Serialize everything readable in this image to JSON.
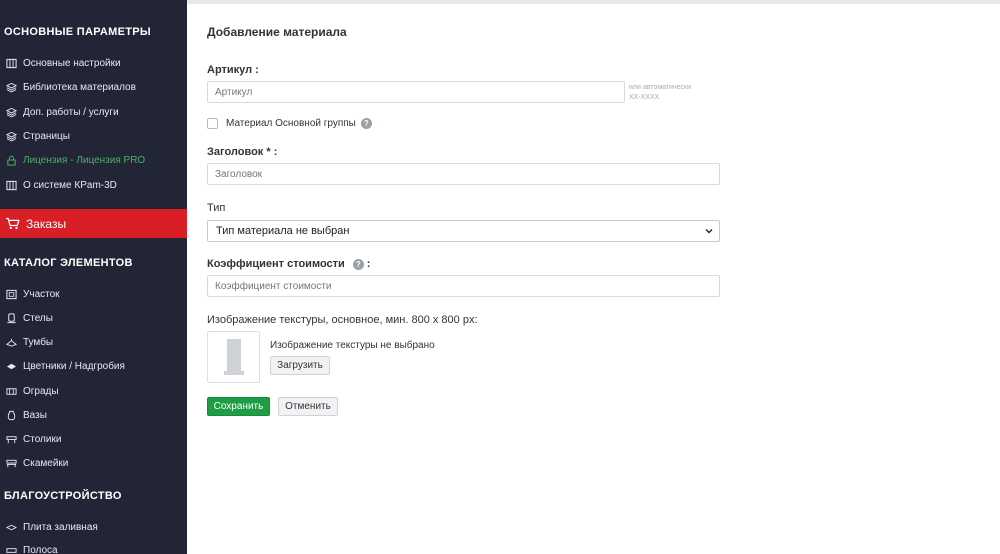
{
  "sidebar": {
    "sections": [
      {
        "title": "ОСНОВНЫЕ ПАРАМЕТРЫ"
      },
      {
        "title": "КАТАЛОГ ЭЛЕМЕНТОВ"
      },
      {
        "title": "БЛАГОУСТРОЙСТВО"
      }
    ],
    "main_items": [
      {
        "label": "Основные настройки",
        "icon": "columns-icon"
      },
      {
        "label": "Библиотека материалов",
        "icon": "layers-icon"
      },
      {
        "label": "Доп. работы / услуги",
        "icon": "layers-icon"
      },
      {
        "label": "Страницы",
        "icon": "layers-icon"
      },
      {
        "label": "Лицензия - Лицензия PRO",
        "icon": "lock-icon"
      },
      {
        "label": "О системе КРam-3D",
        "icon": "columns-icon"
      }
    ],
    "orders": {
      "label": "Заказы",
      "icon": "cart-icon"
    },
    "catalog_items": [
      {
        "label": "Участок",
        "icon": "plot-icon"
      },
      {
        "label": "Стелы",
        "icon": "stele-icon"
      },
      {
        "label": "Тумбы",
        "icon": "pedestal-icon"
      },
      {
        "label": "Цветники / Надгробия",
        "icon": "flowerbed-icon"
      },
      {
        "label": "Ограды",
        "icon": "fence-icon"
      },
      {
        "label": "Вазы",
        "icon": "vase-icon"
      },
      {
        "label": "Столики",
        "icon": "table-icon"
      },
      {
        "label": "Скамейки",
        "icon": "bench-icon"
      }
    ],
    "landscape_items": [
      {
        "label": "Плита заливная",
        "icon": "slab-icon"
      },
      {
        "label": "Полоса",
        "icon": "strip-icon"
      }
    ]
  },
  "form": {
    "title": "Добавление материала",
    "article": {
      "label": "Артикул :",
      "placeholder": "Артикул",
      "hint_line1": "или автоматически",
      "hint_line2": "XX-XXXX"
    },
    "main_group_checkbox": {
      "label": "Материал Основной группы",
      "checked": false
    },
    "heading": {
      "label": "Заголовок * :",
      "placeholder": "Заголовок"
    },
    "type": {
      "label": "Тип",
      "selected": "Тип материала не выбран"
    },
    "cost": {
      "label": "Коэффициент стоимости",
      "colon": ":",
      "placeholder": "Коэффициент стоимости"
    },
    "texture": {
      "label": "Изображение текстуры, основное, мин. 800 x 800 px:",
      "status": "Изображение текстуры не выбрано",
      "upload_label": "Загрузить"
    },
    "save_label": "Сохранить",
    "cancel_label": "Отменить"
  },
  "colors": {
    "sidebar_bg": "#222535",
    "orders_bg": "#d81f26",
    "license_green": "#4caf6a",
    "save_green": "#1f9d45"
  }
}
